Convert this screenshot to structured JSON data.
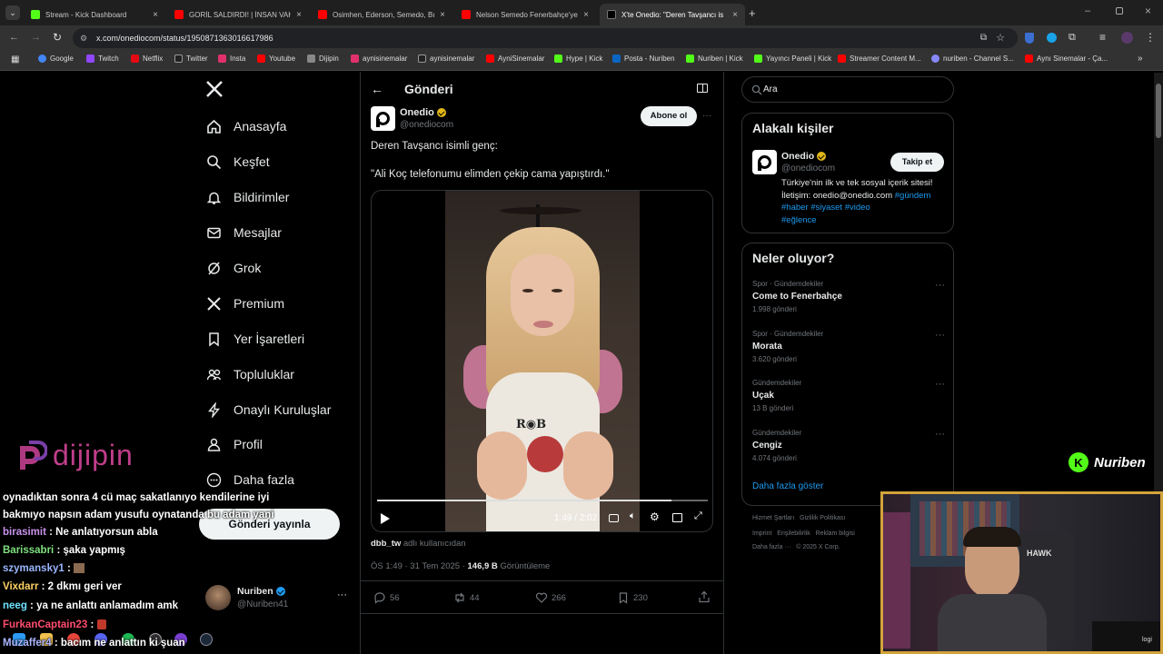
{
  "browser": {
    "tabs": [
      {
        "label": "Stream - Kick Dashboard",
        "color": "#53fc18"
      },
      {
        "label": "GORİL SALDIRDI! | İNSAN VAHŞ",
        "color": "#ff0000"
      },
      {
        "label": "Osimhen, Ederson, Semedo, Bı",
        "color": "#ff0000"
      },
      {
        "label": "Nelson Semedo Fenerbahçe'ye",
        "color": "#ff0000"
      },
      {
        "label": "X'te Onedio: \"Deren Tavşancı is",
        "color": "#ffffff"
      }
    ],
    "url": "x.com/onediocom/status/1950871363016617986",
    "bookmarks": [
      {
        "label": "Google",
        "color": "#4285f4"
      },
      {
        "label": "Twitch",
        "color": "#9146ff"
      },
      {
        "label": "Netflix",
        "color": "#e50914"
      },
      {
        "label": "Twitter",
        "color": "#ffffff"
      },
      {
        "label": "Insta",
        "color": "#e1306c"
      },
      {
        "label": "Youtube",
        "color": "#ff0000"
      },
      {
        "label": "Dijipin",
        "color": "#888888"
      },
      {
        "label": "aynisinemalar",
        "color": "#e1306c"
      },
      {
        "label": "aynisinemalar",
        "color": "#ffffff"
      },
      {
        "label": "AyniSinemalar",
        "color": "#ff0000"
      },
      {
        "label": "Hype | Kick",
        "color": "#53fc18"
      },
      {
        "label": "Posta - Nuriben",
        "color": "#0a66c2"
      },
      {
        "label": "Nuriben | Kick",
        "color": "#53fc18"
      },
      {
        "label": "Yayıncı Paneli | Kick",
        "color": "#53fc18"
      },
      {
        "label": "Streamer Content M...",
        "color": "#ff0000"
      },
      {
        "label": "nuriben - Channel S...",
        "color": "#8888ff"
      },
      {
        "label": "Aynı Sinemalar - Ça...",
        "color": "#ff0000"
      }
    ]
  },
  "nav": {
    "items": [
      "Anasayfa",
      "Keşfet",
      "Bildirimler",
      "Mesajlar",
      "Grok",
      "Premium",
      "Yer İşaretleri",
      "Topluluklar",
      "Onaylı Kuruluşlar",
      "Profil",
      "Daha fazla"
    ],
    "post_button": "Gönderi yayınla",
    "account_name": "Nuriben",
    "account_handle": "@Nuriben41"
  },
  "post": {
    "header": "Gönderi",
    "author": "Onedio",
    "handle": "@onediocom",
    "subscribe": "Abone ol",
    "text_line1": "Deren Tavşancı isimli genç:",
    "text_line2": "\"Ali Koç telefonumu elimden çekip cama yapıştırdı.\"",
    "video_time": "1:49 / 2:02",
    "video_progress": 0.89,
    "source_user": "dbb_tw",
    "source_suffix": "adlı kullanıcıdan",
    "time": "ÖS 1:49 · 31 Tem 2025 ·",
    "views_count": "146,9 B",
    "views_label": "Görüntüleme",
    "replies": "56",
    "reposts": "44",
    "likes": "266",
    "bookmarks": "230"
  },
  "right": {
    "search_placeholder": "Ara",
    "relevant_title": "Alakalı kişiler",
    "rel_name": "Onedio",
    "rel_handle": "@onediocom",
    "follow": "Takip et",
    "bio": "Türkiye'nin ilk ve tek sosyal içerik sitesi! İletişim: onedio@onedio.com",
    "bio_tags": "#gündem #haber #siyaset #video",
    "bio_tags2": "#eğlence",
    "whats_title": "Neler oluyor?",
    "trends": [
      {
        "category": "Spor · Gündemdekiler",
        "name": "Come to Fenerbahçe",
        "count": "1.998 gönderi"
      },
      {
        "category": "Spor · Gündemdekiler",
        "name": "Morata",
        "count": "3.620 gönderi"
      },
      {
        "category": "Gündemdekiler",
        "name": "Uçak",
        "count": "13 B gönderi"
      },
      {
        "category": "Gündemdekiler",
        "name": "Cengiz",
        "count": "4.074 gönderi"
      }
    ],
    "show_more": "Daha fazla göster",
    "footer1": "Hizmet Şartları   Gizlilik Politikası",
    "footer2": "Imprint   Erişilebilirlik   Reklam bilgisi",
    "footer3": "Daha fazla ···   © 2025 X Corp."
  },
  "overlay": {
    "dijipin_logo": "dijipin",
    "nuriben_logo": "Nuriben",
    "chat": [
      {
        "user": "",
        "text": "oynadıktan sonra 4 cü maç sakatlanıyo kendilerine iyi",
        "color": "#ffffff"
      },
      {
        "user": "",
        "text": "bakmıyo napsın adam yusufu oynatanda bu adam yani",
        "color": "#ffffff"
      },
      {
        "user": "birasimit",
        "text": ": Ne anlatıyorsun abla",
        "color": "#c792ea"
      },
      {
        "user": "Barissabri",
        "text": ": şaka yapmış",
        "color": "#7ee07e"
      },
      {
        "user": "szymansky1",
        "text": ":",
        "color": "#9ab6ff"
      },
      {
        "user": "Vixdarr",
        "text": ": 2 dkmı geri ver",
        "color": "#ffd166"
      },
      {
        "user": "neeg",
        "text": ": ya ne anlattı anlamadım amk",
        "color": "#6fe3ff"
      },
      {
        "user": "FurkanCaptain23",
        "text": ":",
        "color": "#ff4d6d"
      },
      {
        "user": "Muzaffer4",
        "text": ": bacım ne anlattın ki şuan",
        "color": "#aab4ff"
      }
    ],
    "webcam_tag": "logi"
  }
}
